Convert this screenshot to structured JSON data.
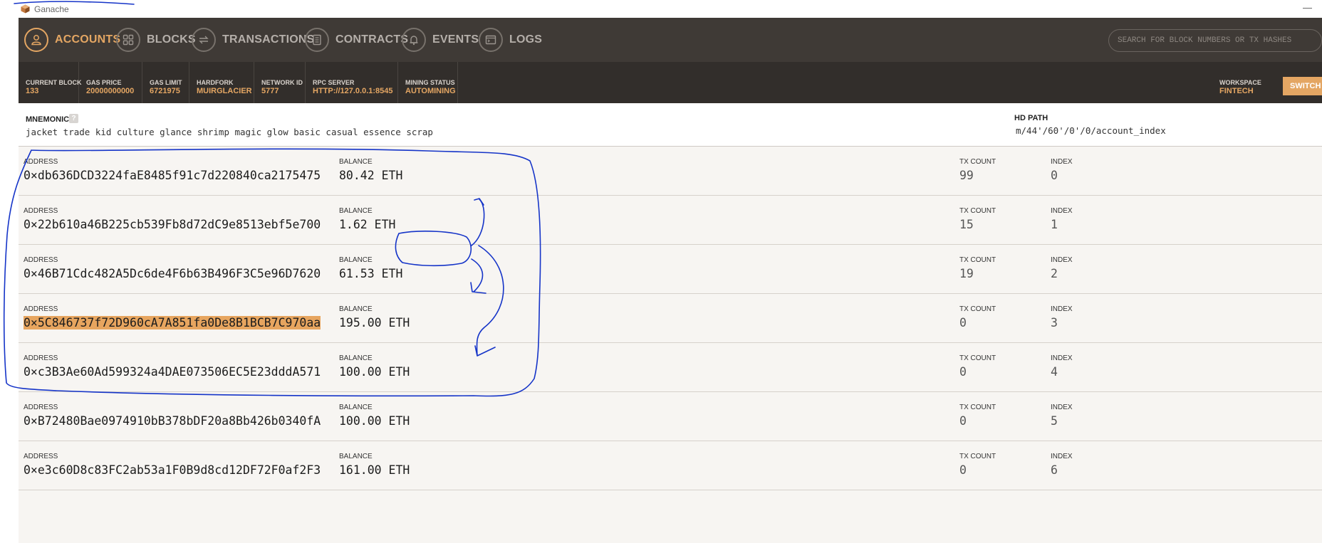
{
  "window": {
    "title": "Ganache",
    "minimize": "—"
  },
  "nav": {
    "items": [
      {
        "label": "ACCOUNTS",
        "icon": "person-icon",
        "active": true
      },
      {
        "label": "BLOCKS",
        "icon": "blocks-grid-icon",
        "active": false
      },
      {
        "label": "TRANSACTIONS",
        "icon": "arrows-swap-icon",
        "active": false
      },
      {
        "label": "CONTRACTS",
        "icon": "document-icon",
        "active": false
      },
      {
        "label": "EVENTS",
        "icon": "bell-icon",
        "active": false
      },
      {
        "label": "LOGS",
        "icon": "terminal-icon",
        "active": false
      }
    ],
    "search_placeholder": "SEARCH FOR BLOCK NUMBERS OR TX HASHES"
  },
  "status": {
    "current_block": {
      "label": "CURRENT BLOCK",
      "value": "133"
    },
    "gas_price": {
      "label": "GAS PRICE",
      "value": "20000000000"
    },
    "gas_limit": {
      "label": "GAS LIMIT",
      "value": "6721975"
    },
    "hardfork": {
      "label": "HARDFORK",
      "value": "MUIRGLACIER"
    },
    "network_id": {
      "label": "NETWORK ID",
      "value": "5777"
    },
    "rpc_server": {
      "label": "RPC SERVER",
      "value": "HTTP://127.0.0.1:8545"
    },
    "mining_status": {
      "label": "MINING STATUS",
      "value": "AUTOMINING"
    },
    "workspace": {
      "label": "WORKSPACE",
      "value": "FINTECH"
    },
    "switch_label": "SWITCH"
  },
  "mnemonic": {
    "label": "MNEMONIC",
    "help": "?",
    "words": "jacket trade kid culture glance shrimp magic glow basic casual essence scrap",
    "hd_path_label": "HD PATH",
    "hd_path_value": "m/44'/60'/0'/0/account_index"
  },
  "account_headers": {
    "address": "ADDRESS",
    "balance": "BALANCE",
    "tx_count": "TX COUNT",
    "index": "INDEX"
  },
  "accounts": [
    {
      "address": "0×db636DCD3224faE8485f91c7d220840ca2175475",
      "balance": "80.42 ETH",
      "tx_count": "99",
      "index": "0"
    },
    {
      "address": "0×22b610a46B225cb539Fb8d72dC9e8513ebf5e700",
      "balance": "1.62 ETH",
      "tx_count": "15",
      "index": "1"
    },
    {
      "address": "0×46B71Cdc482A5Dc6de4F6b63B496F3C5e96D7620",
      "balance": "61.53 ETH",
      "tx_count": "19",
      "index": "2"
    },
    {
      "address": "0×5C846737f72D960cA7A851fa0De8B1BCB7C970aa",
      "balance": "195.00 ETH",
      "tx_count": "0",
      "index": "3",
      "selected": true
    },
    {
      "address": "0×c3B3Ae60Ad599324a4DAE073506EC5E23dddA571",
      "balance": "100.00 ETH",
      "tx_count": "0",
      "index": "4"
    },
    {
      "address": "0×B72480Bae0974910bB378bDF20a8Bb426b0340fA",
      "balance": "100.00 ETH",
      "tx_count": "0",
      "index": "5"
    },
    {
      "address": "0×e3c60D8c83FC2ab53a1F0B9d8cd12DF72F0af2F3",
      "balance": "161.00 ETH",
      "tx_count": "0",
      "index": "6"
    }
  ],
  "colors": {
    "accent": "#e4a663",
    "nav_bg": "#3f3a36",
    "status_bg": "#322e2b",
    "ink": "#1534c8"
  }
}
